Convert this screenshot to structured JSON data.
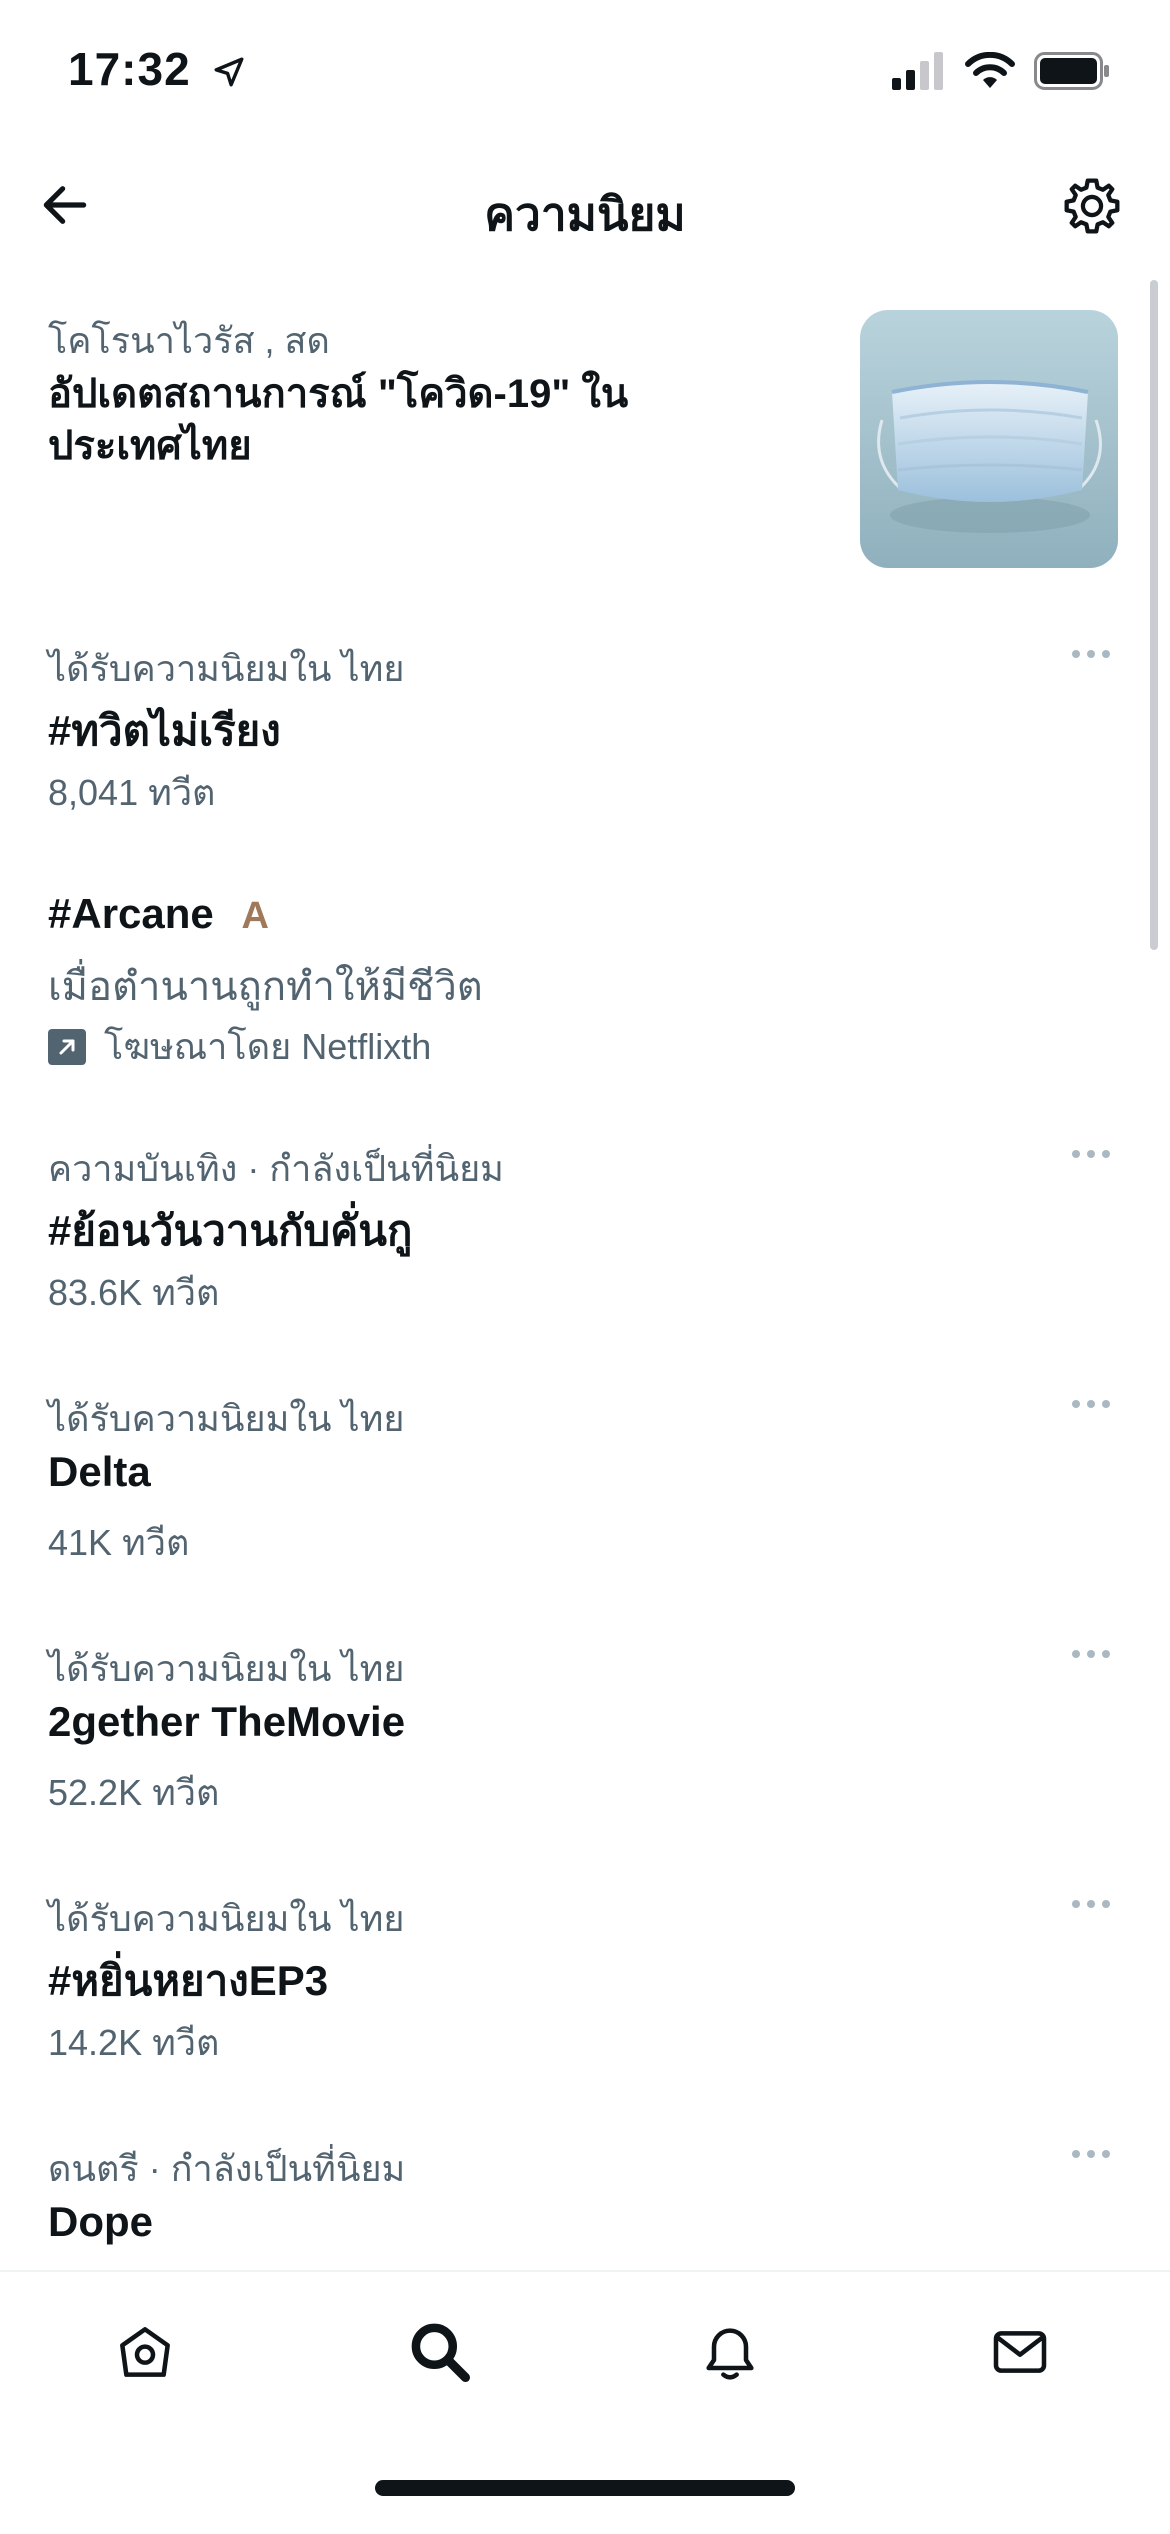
{
  "status_bar": {
    "time": "17:32"
  },
  "header": {
    "title": "ความนิยม"
  },
  "featured": {
    "meta": "โคโรนาไวรัส , สด",
    "headline": "อัปเดตสถานการณ์ \"โควิด-19\" ในประเทศไทย"
  },
  "trends": [
    {
      "context": "ได้รับความนิยมใน ไทย",
      "name": "#ทวิตไม่เรียง",
      "count": "8,041 ทวีต"
    },
    {
      "context": "ความบันเทิง · กำลังเป็นที่นิยม",
      "name": "#ย้อนวันวานกับคั่นกู",
      "count": "83.6K ทวีต"
    },
    {
      "context": "ได้รับความนิยมใน ไทย",
      "name": "Delta",
      "count": "41K ทวีต"
    },
    {
      "context": "ได้รับความนิยมใน ไทย",
      "name": "2gether TheMovie",
      "count": "52.2K ทวีต"
    },
    {
      "context": "ได้รับความนิยมใน ไทย",
      "name": "#หยิ่นหยางEP3",
      "count": "14.2K ทวีต"
    },
    {
      "context": "ดนตรี · กำลังเป็นที่นิยม",
      "name": "Dope",
      "count": ""
    }
  ],
  "promoted": {
    "name": "#Arcane",
    "badge": "A",
    "description": "เมื่อตำนานถูกทำให้มีชีวิต",
    "promoted_by": "โฆษณาโดย Netflixth"
  },
  "tabs": [
    "home-icon",
    "search-icon",
    "notifications-icon",
    "messages-icon"
  ],
  "colors": {
    "text": "#0f1419",
    "secondary": "#536471",
    "accent_badge": "#a0785a"
  }
}
